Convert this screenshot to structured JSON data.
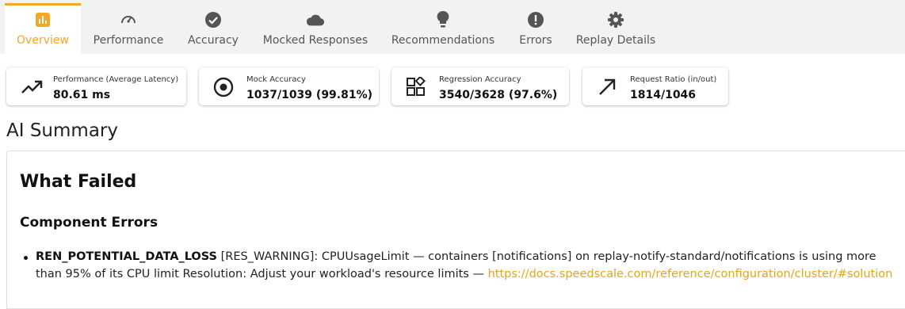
{
  "tabs": [
    {
      "label": "Overview",
      "icon": "bar-chart-icon",
      "active": true
    },
    {
      "label": "Performance",
      "icon": "speedometer-icon",
      "active": false
    },
    {
      "label": "Accuracy",
      "icon": "check-circle-icon",
      "active": false
    },
    {
      "label": "Mocked Responses",
      "icon": "cloud-icon",
      "active": false
    },
    {
      "label": "Recommendations",
      "icon": "lightbulb-icon",
      "active": false
    },
    {
      "label": "Errors",
      "icon": "error-icon",
      "active": false
    },
    {
      "label": "Replay Details",
      "icon": "gear-icon",
      "active": false
    }
  ],
  "cards": [
    {
      "title": "Performance (Average Latency)",
      "value": "80.61 ms",
      "icon": "trending-up-icon"
    },
    {
      "title": "Mock Accuracy",
      "value": "1037/1039 (99.81%)",
      "icon": "target-icon"
    },
    {
      "title": "Regression Accuracy",
      "value": "3540/3628 (97.6%)",
      "icon": "widgets-icon"
    },
    {
      "title": "Request Ratio (in/out)",
      "value": "1814/1046",
      "icon": "arrow-up-right-icon"
    }
  ],
  "summary": {
    "title": "AI Summary",
    "heading": "What Failed",
    "subheading": "Component Errors",
    "errors": [
      {
        "code": "REN_POTENTIAL_DATA_LOSS",
        "text": " [RES_WARNING]: CPUUsageLimit — containers [notifications] on replay-notify-standard/notifications is using more than 95% of its CPU limit Resolution: Adjust your workload's resource limits — ",
        "link": "https://docs.speedscale.com/reference/configuration/cluster/#solution"
      }
    ]
  },
  "colors": {
    "accent": "#f5a623",
    "tab_bg": "#f2f2f2",
    "icon": "#555555"
  }
}
